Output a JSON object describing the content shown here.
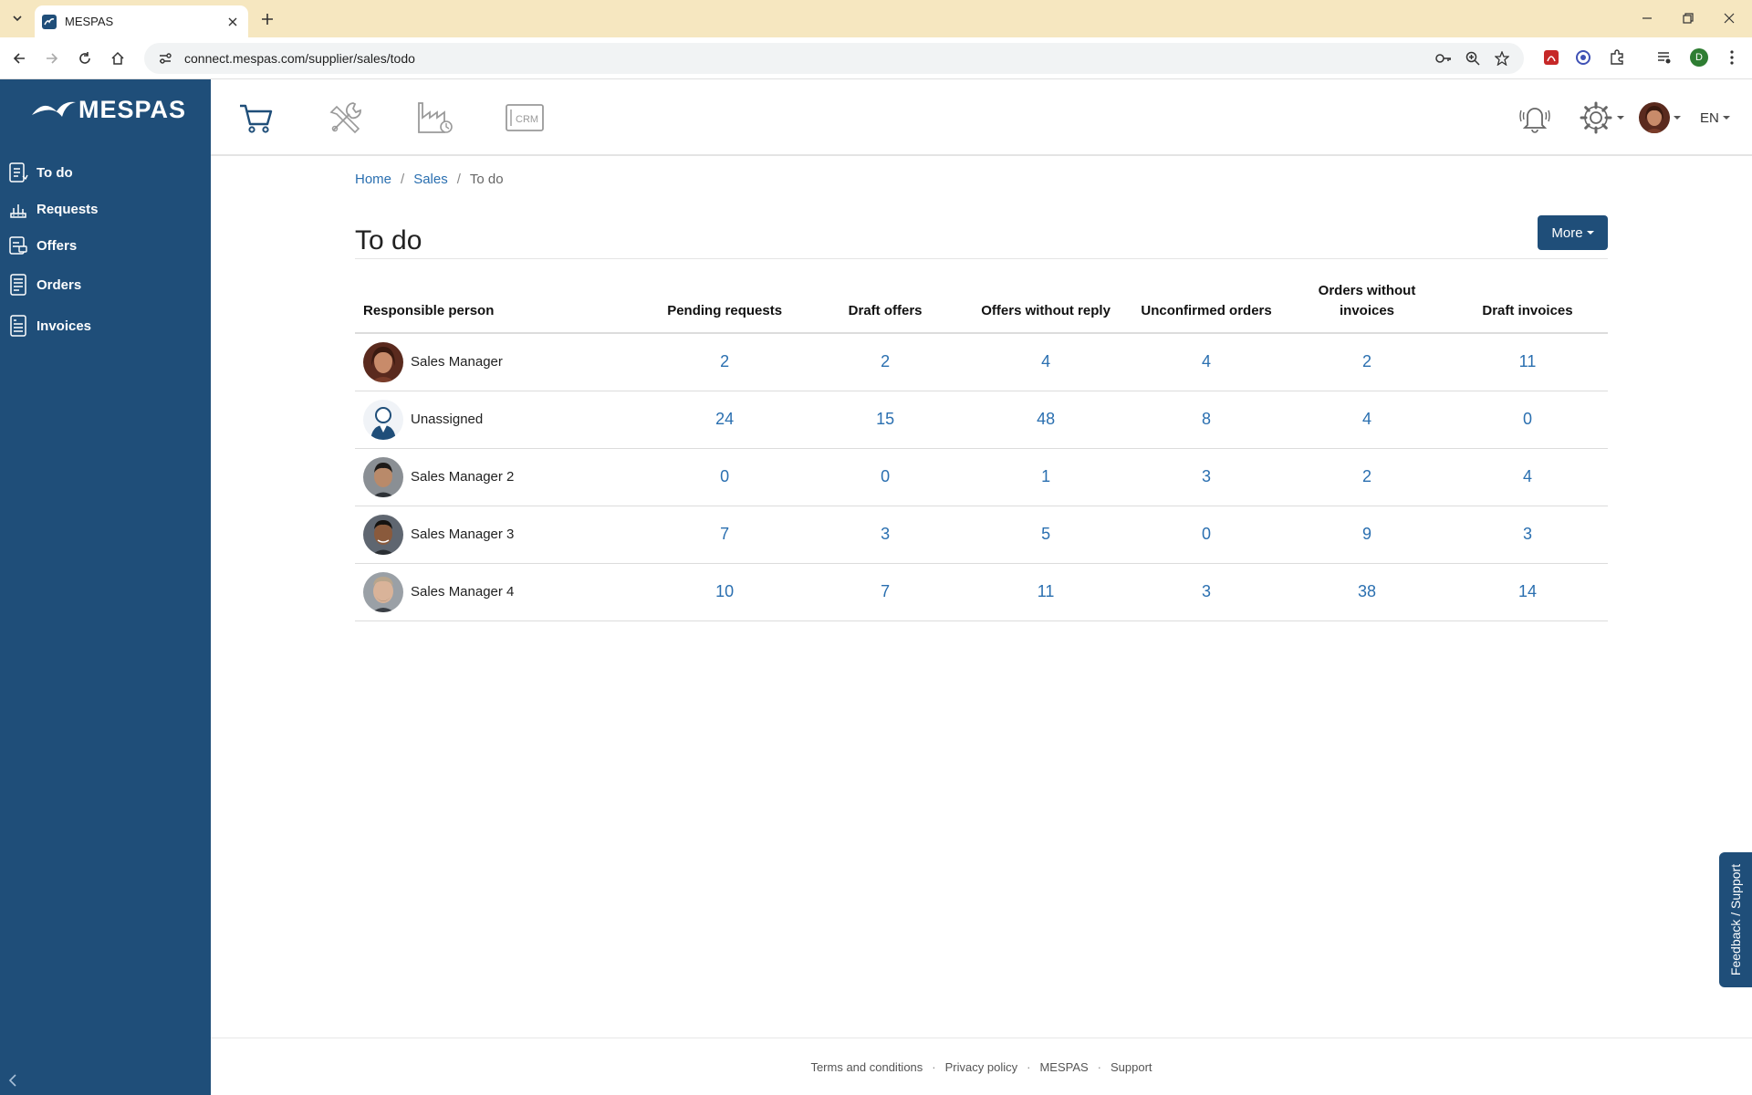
{
  "browser": {
    "tab_title": "MESPAS",
    "url": "connect.mespas.com/supplier/sales/todo",
    "profile_initial": "D"
  },
  "app": {
    "logo": "MESPAS",
    "brand_color": "#1f4e79",
    "link_color": "#2a6fb0"
  },
  "sidebar": {
    "items": [
      {
        "label": "To do",
        "icon": "todo-list-icon"
      },
      {
        "label": "Requests",
        "icon": "requests-icon"
      },
      {
        "label": "Offers",
        "icon": "offers-icon"
      },
      {
        "label": "Orders",
        "icon": "orders-icon"
      },
      {
        "label": "Invoices",
        "icon": "invoices-icon"
      }
    ]
  },
  "header": {
    "modules": [
      "cart-icon",
      "tools-icon",
      "factory-icon",
      "crm-icon"
    ],
    "crm_label": "CRM",
    "language": "EN"
  },
  "breadcrumb": {
    "home": "Home",
    "sales": "Sales",
    "current": "To do"
  },
  "page": {
    "title": "To do",
    "more_label": "More"
  },
  "table": {
    "headers": {
      "person": "Responsible person",
      "pending_requests": "Pending requests",
      "draft_offers": "Draft offers",
      "offers_without_reply": "Offers without reply",
      "unconfirmed_orders": "Unconfirmed orders",
      "orders_without_invoices": "Orders without invoices",
      "draft_invoices": "Draft invoices"
    },
    "rows": [
      {
        "name": "Sales Manager",
        "values": [
          "2",
          "2",
          "4",
          "4",
          "2",
          "11"
        ]
      },
      {
        "name": "Unassigned",
        "values": [
          "24",
          "15",
          "48",
          "8",
          "4",
          "0"
        ]
      },
      {
        "name": "Sales Manager 2",
        "values": [
          "0",
          "0",
          "1",
          "3",
          "2",
          "4"
        ]
      },
      {
        "name": "Sales Manager 3",
        "values": [
          "7",
          "3",
          "5",
          "0",
          "9",
          "3"
        ]
      },
      {
        "name": "Sales Manager 4",
        "values": [
          "10",
          "7",
          "11",
          "3",
          "38",
          "14"
        ]
      }
    ]
  },
  "footer": {
    "terms": "Terms and conditions",
    "privacy": "Privacy policy",
    "brand": "MESPAS",
    "support": "Support",
    "separator": "·"
  },
  "feedback": {
    "label": "Feedback / Support"
  }
}
